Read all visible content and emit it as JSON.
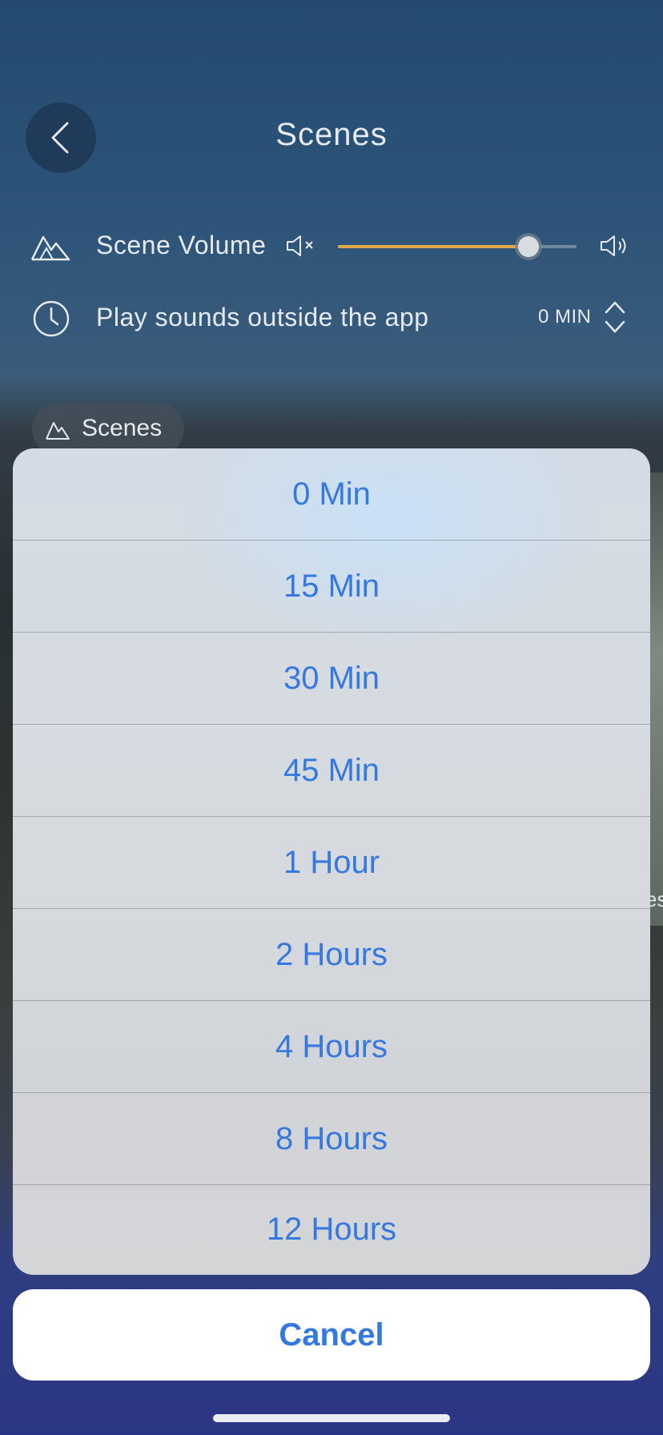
{
  "header": {
    "title": "Scenes",
    "back_icon": "chevron-left-icon"
  },
  "volume": {
    "label": "Scene Volume",
    "mute_icon": "speaker-mute-icon",
    "max_icon": "speaker-loud-icon",
    "level": 0.8
  },
  "outside_app": {
    "label": "Play sounds outside the app",
    "value": "0 MIN",
    "icon": "clock-icon"
  },
  "scenes_chip": {
    "label": "Scenes",
    "icon": "mountain-icon"
  },
  "scene_card": {
    "partial_text": "es"
  },
  "sheet": {
    "options": [
      "0 Min",
      "15 Min",
      "30 Min",
      "45 Min",
      "1 Hour",
      "2 Hours",
      "4 Hours",
      "8 Hours",
      "12 Hours"
    ],
    "cancel": "Cancel"
  },
  "colors": {
    "accent_blue": "#3478e0",
    "slider_fill": "#e0a84a",
    "header_bg": "#244a70"
  }
}
